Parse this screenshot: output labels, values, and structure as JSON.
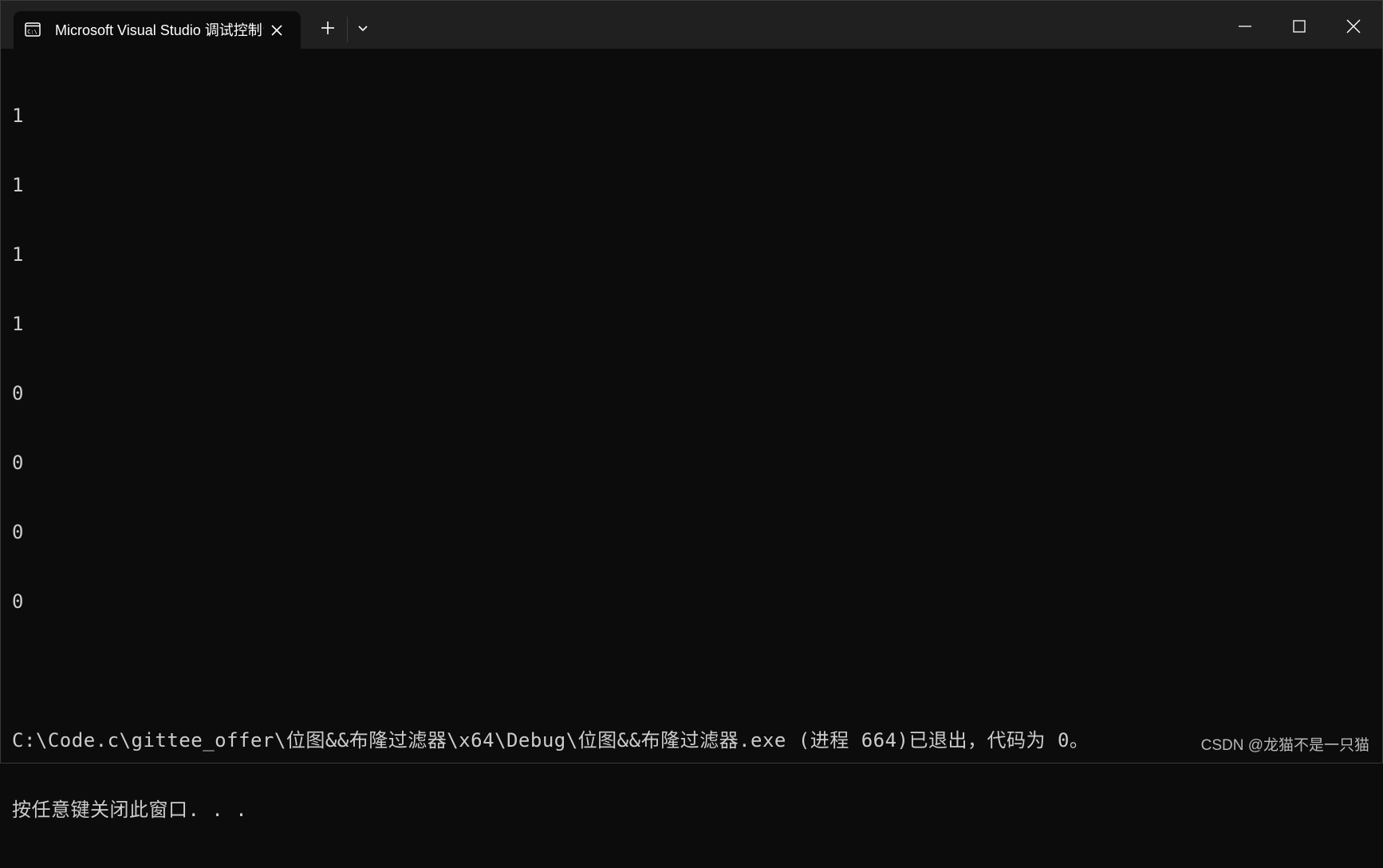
{
  "window": {
    "tab_title": "Microsoft Visual Studio 调试控制台",
    "tab_icon": "terminal-icon",
    "buttons": {
      "minimize": "minimize-icon",
      "maximize": "maximize-icon",
      "close": "close-icon"
    }
  },
  "console": {
    "lines": [
      "1",
      "1",
      "1",
      "1",
      "0",
      "0",
      "0",
      "0"
    ],
    "exit_message": "C:\\Code.c\\gittee_offer\\位图&&布隆过滤器\\x64\\Debug\\位图&&布隆过滤器.exe (进程 664)已退出，代码为 0。",
    "prompt": "按任意键关闭此窗口. . ."
  },
  "watermark": "CSDN @龙猫不是一只猫",
  "colors": {
    "background": "#0c0c0c",
    "titlebar": "#202020",
    "text": "#cccccc"
  }
}
